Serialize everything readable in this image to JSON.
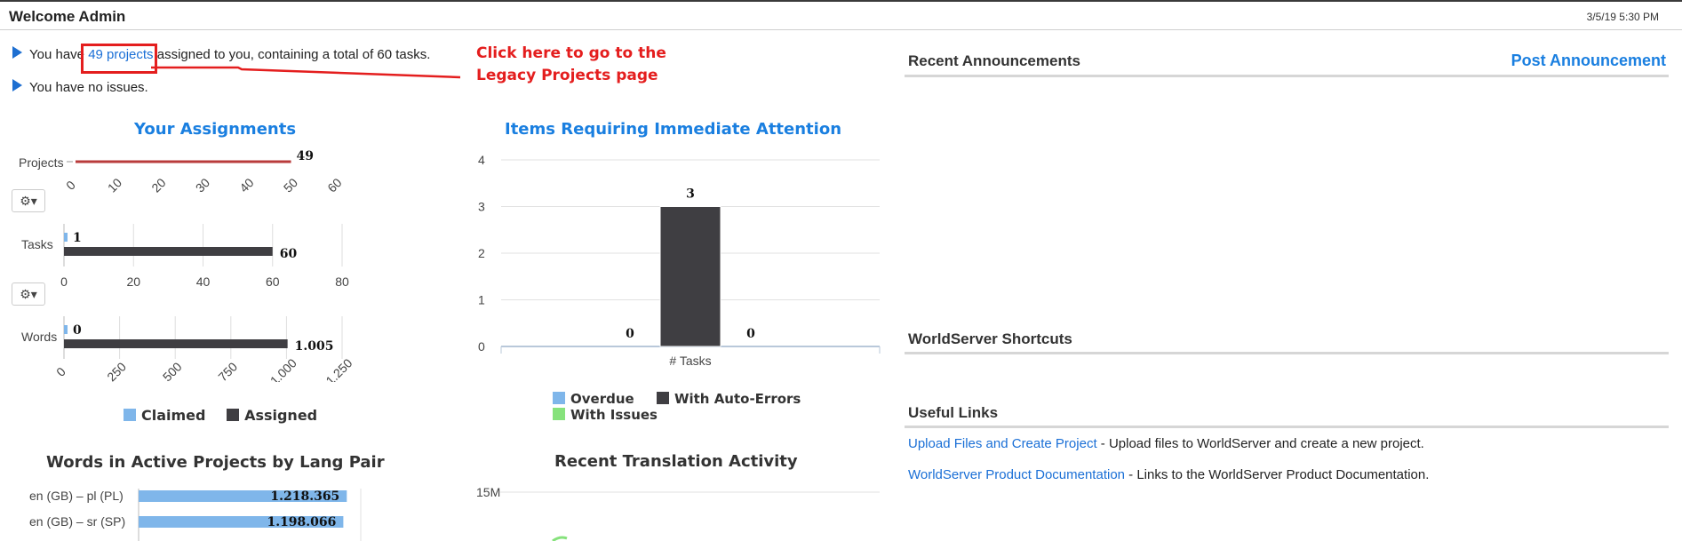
{
  "header": {
    "welcome": "Welcome Admin",
    "datetime": "3/5/19 5:30 PM"
  },
  "messages": {
    "projects_prefix": "You have ",
    "projects_link": "49 projects",
    "projects_suffix": " assigned to you, containing a total of 60 tasks.",
    "issues": "You have no issues."
  },
  "callout": {
    "line1": "Click here to go to the",
    "line2": "Legacy Projects page"
  },
  "assignments": {
    "title": "Your Assignments",
    "menu_icon": "gear-icon",
    "colors": {
      "claimed": "#7fb6ea",
      "assigned": "#3f3e42",
      "projects_bar": "#b93b3b"
    },
    "legend": {
      "claimed": "Claimed",
      "assigned": "Assigned"
    },
    "projects": {
      "label": "Projects",
      "value": 49,
      "value_label": "49",
      "ticks": [
        "0",
        "10",
        "20",
        "30",
        "40",
        "50",
        "60"
      ],
      "max": 60
    },
    "tasks": {
      "label": "Tasks",
      "claimed": 1,
      "assigned": 60,
      "claimed_label": "1",
      "assigned_label": "60",
      "ticks": [
        "0",
        "20",
        "40",
        "60",
        "80"
      ],
      "max": 80
    },
    "words": {
      "label": "Words",
      "claimed": 0,
      "assigned": 1005,
      "claimed_label": "0",
      "assigned_label": "1.005",
      "ticks": [
        "0",
        "250",
        "500",
        "750",
        "1.000",
        "1.250"
      ],
      "max": 1250
    }
  },
  "attention": {
    "title": "Items Requiring Immediate Attention",
    "y_ticks": [
      "0",
      "1",
      "2",
      "3",
      "4"
    ],
    "ymax": 4,
    "category": "# Tasks",
    "series": [
      {
        "name": "Overdue",
        "value": 0,
        "label": "0",
        "color": "#7fb6ea"
      },
      {
        "name": "With Auto-Errors",
        "value": 3,
        "label": "3",
        "color": "#3f3e42"
      },
      {
        "name": "With Issues",
        "value": 0,
        "label": "0",
        "color": "#86e27c"
      }
    ]
  },
  "lang_pair": {
    "title": "Words in Active Projects by Lang Pair",
    "color": "#7fb6ea",
    "rows": [
      {
        "label": "en (GB) – pl (PL)",
        "value": 1218365,
        "value_label": "1.218.365"
      },
      {
        "label": "en (GB) – sr (SP)",
        "value": 1198066,
        "value_label": "1.198.066"
      }
    ]
  },
  "activity": {
    "title": "Recent Translation Activity",
    "y_top": "15M"
  },
  "right": {
    "announcements_title": "Recent Announcements",
    "post_announcement": "Post Announcement",
    "shortcuts_title": "WorldServer Shortcuts",
    "useful_title": "Useful Links",
    "links": [
      {
        "text": "Upload Files and Create Project",
        "desc": " - Upload files to WorldServer and create a new project."
      },
      {
        "text": "WorldServer Product Documentation",
        "desc": " - Links to the WorldServer Product Documentation."
      }
    ]
  },
  "chart_data": [
    {
      "type": "bar",
      "title": "Your Assignments",
      "categories": [
        "Projects",
        "Tasks",
        "Words"
      ],
      "series": [
        {
          "name": "Claimed",
          "values": [
            null,
            1,
            0
          ]
        },
        {
          "name": "Assigned",
          "values": [
            49,
            60,
            1005
          ]
        }
      ]
    },
    {
      "type": "bar",
      "title": "Items Requiring Immediate Attention",
      "categories": [
        "# Tasks"
      ],
      "series": [
        {
          "name": "Overdue",
          "values": [
            0
          ]
        },
        {
          "name": "With Auto-Errors",
          "values": [
            3
          ]
        },
        {
          "name": "With Issues",
          "values": [
            0
          ]
        }
      ],
      "ylim": [
        0,
        4
      ]
    },
    {
      "type": "bar",
      "title": "Words in Active Projects by Lang Pair",
      "categories": [
        "en (GB) – pl (PL)",
        "en (GB) – sr (SP)"
      ],
      "values": [
        1218365,
        1198066
      ]
    }
  ]
}
